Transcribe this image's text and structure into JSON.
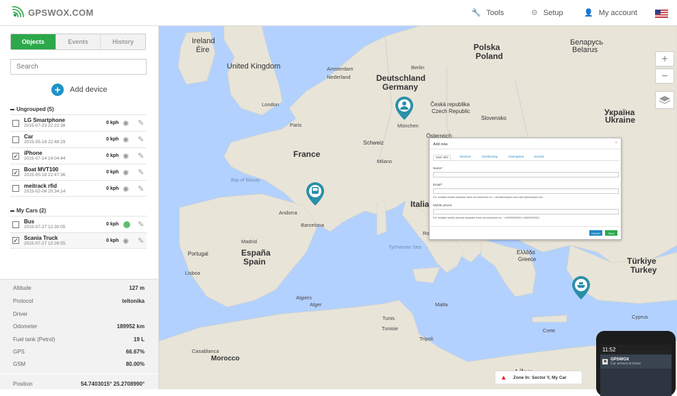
{
  "app": {
    "brand": "GPSWOX.COM"
  },
  "topnav": {
    "tools": "Tools",
    "setup": "Setup",
    "account": "My account",
    "language_flag": "us-flag-icon"
  },
  "tabs": [
    "Objects",
    "Events",
    "History"
  ],
  "search": {
    "placeholder": "Search"
  },
  "add_device": "Add device",
  "groups": [
    {
      "title": "Ungrouped (5)",
      "devices": [
        {
          "name": "LG Smartphone",
          "time": "2015-07-23 22:22:38",
          "speed": "0 kph",
          "checked": false
        },
        {
          "name": "Car",
          "time": "2015-05-18 22:48:29",
          "speed": "0 kph",
          "checked": false
        },
        {
          "name": "iPhone",
          "time": "2015-07-14 14:04:44",
          "speed": "0 kph",
          "checked": true
        },
        {
          "name": "Boat MVT100",
          "time": "2015-05-18 22:47:36",
          "speed": "0 kph",
          "checked": true
        },
        {
          "name": "meitrack rfid",
          "time": "2015-02-08 20:34:14",
          "speed": "0 kph",
          "checked": false
        }
      ]
    },
    {
      "title": "My Cars (2)",
      "devices": [
        {
          "name": "Bus",
          "time": "2015-07-27 12:30:05",
          "speed": "0 kph",
          "checked": false
        },
        {
          "name": "Scania Truck",
          "time": "2015-07-27 12:26:55",
          "speed": "0 kph",
          "checked": true
        }
      ]
    }
  ],
  "details": [
    {
      "label": "Altitude",
      "value": "127 m"
    },
    {
      "label": "Protocol",
      "value": "teltonika"
    },
    {
      "label": "Driver",
      "value": ""
    },
    {
      "label": "Odometer",
      "value": "189952 km"
    },
    {
      "label": "Fuel tank (Petrol)",
      "value": "19 L"
    },
    {
      "label": "GPS",
      "value": "66.67%"
    },
    {
      "label": "GSM",
      "value": "80.00%"
    },
    {
      "label": "Position",
      "value": "54.7403015° 25.2708990°"
    }
  ],
  "map": {
    "labels": [
      "Ireland",
      "Éire",
      "United Kingdom",
      "Polska",
      "Poland",
      "Беларусь",
      "Belarus",
      "Deutschland",
      "Germany",
      "Česká republika",
      "Czech Republic",
      "Slovensko",
      "Україна",
      "Ukraine",
      "Österreich",
      "Schweiz",
      "France",
      "Italia",
      "España",
      "Spain",
      "Portugal",
      "Ελλάδα",
      "Greece",
      "Türkiye",
      "Turkey"
    ],
    "cities": [
      "London",
      "Amsterdam",
      "Nederland",
      "Berlin",
      "Paris",
      "München",
      "Milano",
      "Bay of Biscay",
      "Andorra",
      "Barcelona",
      "Roma",
      "Tyrrhenian Sea",
      "Madrid",
      "Lisboa",
      "Malta",
      "Tunis",
      "Tunisie",
      "Tripoli",
      "Casablanca",
      "Morocco",
      "Algiers",
      "Crete",
      "Cyprus",
      "Libya",
      "Alger"
    ],
    "zoom_in": "+",
    "zoom_out": "−"
  },
  "modal": {
    "title": "Add new",
    "close": "×",
    "tabs": [
      "User info",
      "Devices",
      "Geofencing",
      "Overspeed",
      "Events"
    ],
    "name_label": "Name*:",
    "email_label": "Email*:",
    "email_hint": "For multiple emails separate them via semicolon ex.: user@example.com;user1@example.com",
    "mobile_label": "Mobile phone:",
    "mobile_hint": "For multiple mobile phones separate them via semicolon ex.: +44000000000;+44000000001",
    "cancel": "Cancel",
    "save": "Save"
  },
  "toast": {
    "text": "Zone In: Sector Y, My Car"
  },
  "phone": {
    "time": "11:52",
    "brand": "GPSWOX",
    "message": "Car arrived at home"
  },
  "colors": {
    "accent": "#2ca84a",
    "link": "#1e93c8",
    "map_water": "#b3d1ff",
    "map_land": "#e8e4d8",
    "marker": "#2a8fa8"
  }
}
